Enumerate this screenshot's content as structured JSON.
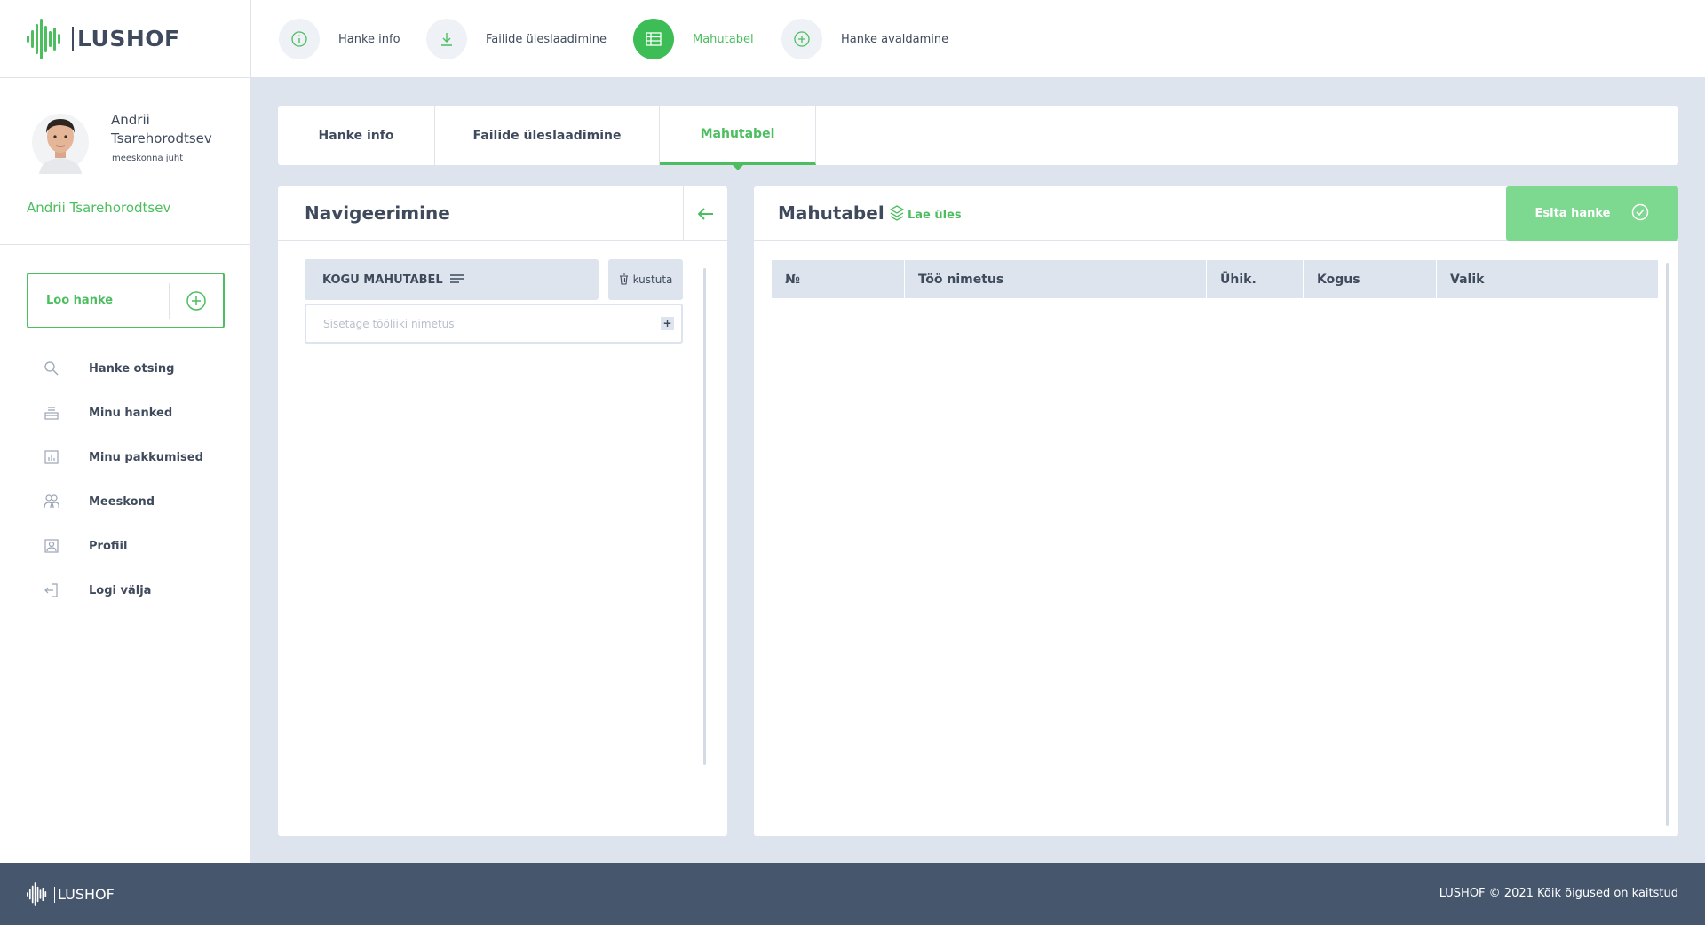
{
  "brand": {
    "name": "LUSHOF",
    "accent": "#4cbe5f"
  },
  "user": {
    "first_name": "Andrii",
    "last_name": "Tsarehorodtsev",
    "role": "meeskonna juht",
    "link_name": "Andrii Tsarehorodtsev"
  },
  "sidebar": {
    "create_label": "Loo hanke",
    "items": [
      {
        "label": "Hanke otsing",
        "icon": "search-icon"
      },
      {
        "label": "Minu hanked",
        "icon": "inbox-icon"
      },
      {
        "label": "Minu pakkumised",
        "icon": "chart-icon"
      },
      {
        "label": "Meeskond",
        "icon": "team-icon"
      },
      {
        "label": "Profiil",
        "icon": "profile-icon"
      },
      {
        "label": "Logi välja",
        "icon": "logout-icon"
      }
    ]
  },
  "steps": [
    {
      "label": "Hanke info",
      "icon": "info-icon",
      "active": false
    },
    {
      "label": "Failide üleslaadimine",
      "icon": "download-icon",
      "active": false
    },
    {
      "label": "Mahutabel",
      "icon": "table-icon",
      "active": true
    },
    {
      "label": "Hanke avaldamine",
      "icon": "plus-circle-icon",
      "active": false
    }
  ],
  "tabs": [
    {
      "label": "Hanke info"
    },
    {
      "label": "Failide üleslaadimine"
    },
    {
      "label": "Mahutabel",
      "active": true
    }
  ],
  "navigation": {
    "title": "Navigeerimine",
    "kogu_label": "KOGU MAHUTABEL",
    "delete_label": "kustuta",
    "input_placeholder": "Sisetage tööliiki nimetus",
    "input_value": ""
  },
  "table": {
    "title": "Mahutabel",
    "upload_label": "Lae üles",
    "submit_label": "Esita hanke",
    "columns": [
      "№",
      "Töö nimetus",
      "Ühik.",
      "Kogus",
      "Valik"
    ],
    "rows": []
  },
  "footer": {
    "copyright": "LUSHOF © 2021 Kõik õigused on kaitstud"
  }
}
